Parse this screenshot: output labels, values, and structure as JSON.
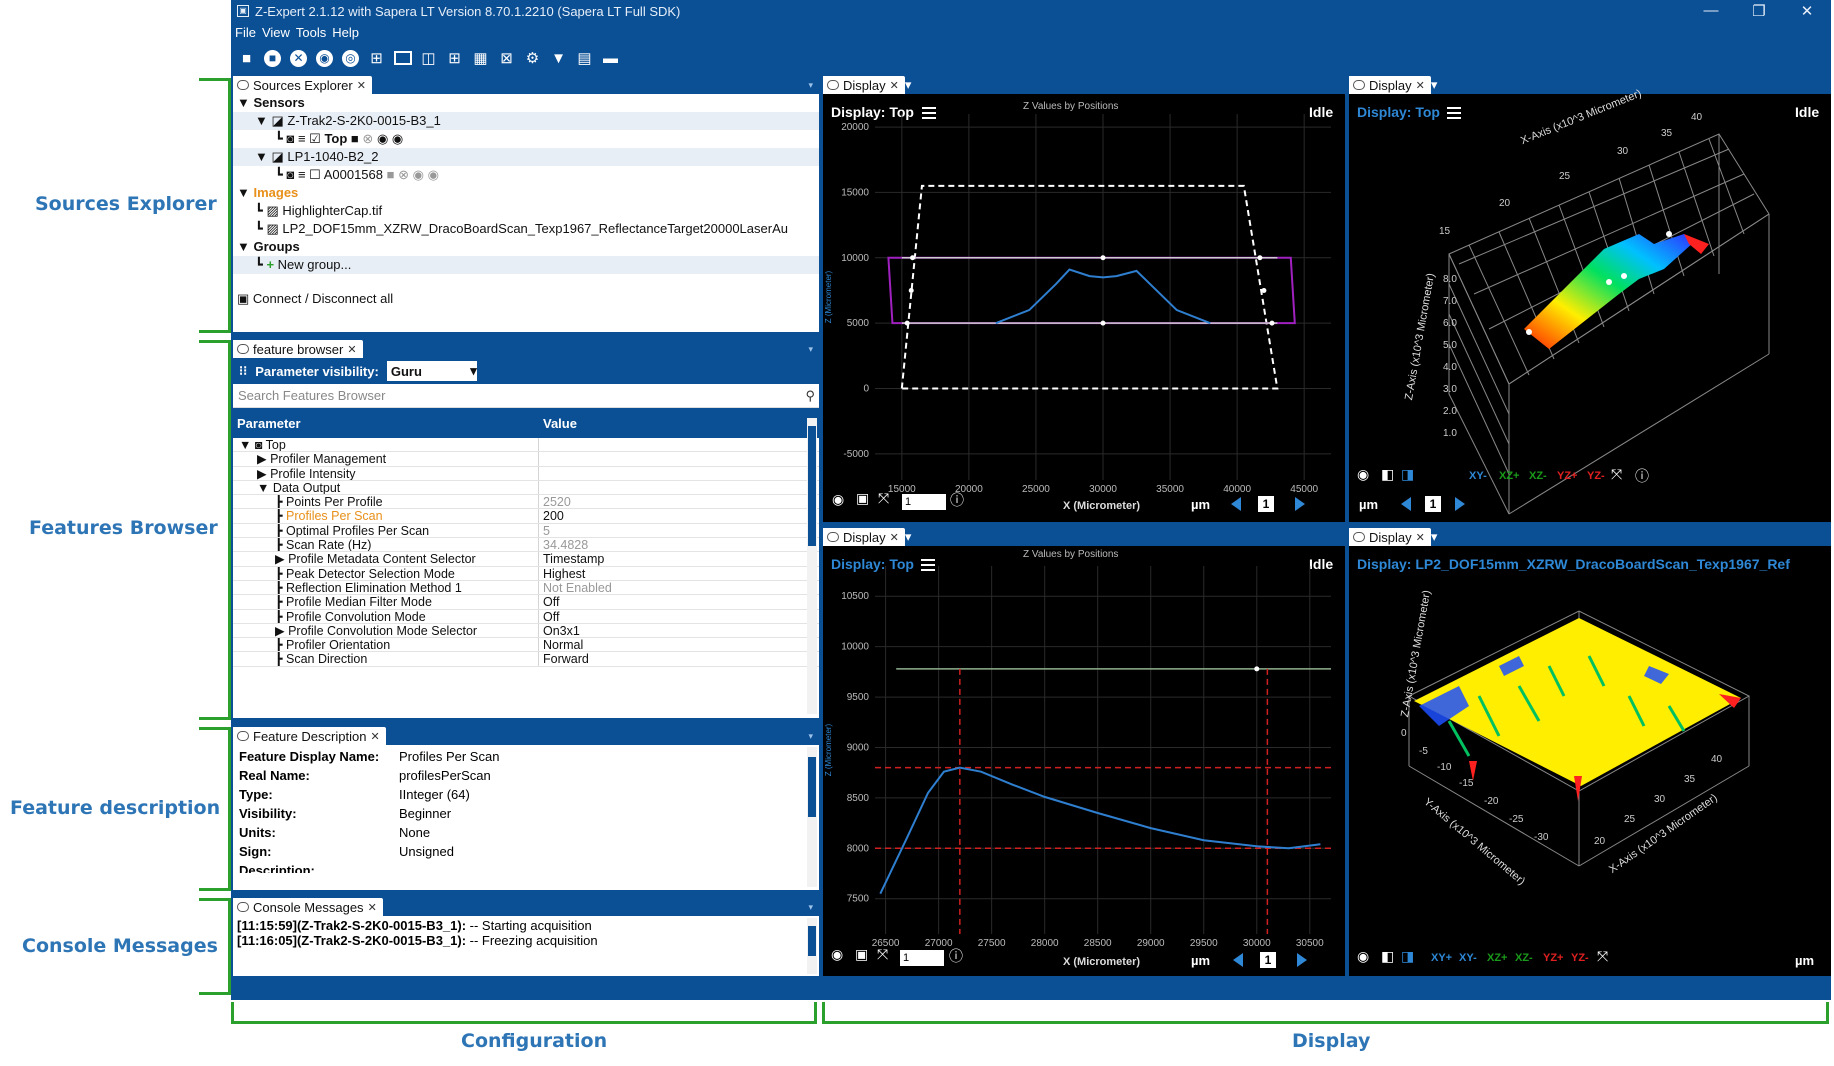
{
  "window": {
    "title": "Z-Expert 2.1.12 with Sapera LT Version 8.70.1.2210 (Sapera LT Full SDK)",
    "controls": [
      "—",
      "❐",
      "✕"
    ]
  },
  "menu": [
    "File",
    "View",
    "Tools",
    "Help"
  ],
  "annotations": {
    "sources_explorer": "Sources Explorer",
    "features_browser": "Features Browser",
    "feature_description": "Feature description",
    "console_messages": "Console Messages",
    "configuration": "Configuration",
    "display": "Display"
  },
  "sources": {
    "tab": "Sources Explorer",
    "sensors_label": "Sensors",
    "sensor1": "Z-Trak2-S-2K0-0015-B3_1",
    "sensor1_child": "Top",
    "sensor2": "LP1-1040-B2_2",
    "sensor2_child": "A0001568",
    "images_label": "Images",
    "image1": "HighlighterCap.tif",
    "image2": "LP2_DOF15mm_XZRW_DracoBoardScan_Texp1967_ReflectanceTarget20000LaserAu",
    "groups_label": "Groups",
    "new_group": "New group...",
    "connect_all": "Connect / Disconnect all"
  },
  "features": {
    "tab": "feature browser",
    "visibility_label": "Parameter visibility:",
    "visibility_value": "Guru",
    "search_placeholder": "Search Features Browser",
    "col_param": "Parameter",
    "col_value": "Value",
    "rows": [
      {
        "name": "Top",
        "value": ""
      },
      {
        "name": "Profiler Management",
        "value": ""
      },
      {
        "name": "Profile Intensity",
        "value": ""
      },
      {
        "name": "Data Output",
        "value": ""
      },
      {
        "name": "Points Per Profile",
        "value": "2520"
      },
      {
        "name": "Profiles Per Scan",
        "value": "200"
      },
      {
        "name": "Optimal Profiles Per Scan",
        "value": "5"
      },
      {
        "name": "Scan Rate (Hz)",
        "value": "34.4828"
      },
      {
        "name": "Profile Metadata Content Selector",
        "value": "Timestamp"
      },
      {
        "name": "Peak Detector Selection Mode",
        "value": "Highest"
      },
      {
        "name": "Reflection Elimination Method 1",
        "value": "Not Enabled"
      },
      {
        "name": "Profile Median Filter Mode",
        "value": "Off"
      },
      {
        "name": "Profile Convolution Mode",
        "value": "Off"
      },
      {
        "name": "Profile Convolution Mode Selector",
        "value": "On3x1"
      },
      {
        "name": "Profiler Orientation",
        "value": "Normal"
      },
      {
        "name": "Scan Direction",
        "value": "Forward"
      }
    ]
  },
  "description": {
    "tab": "Feature Description",
    "fields": [
      {
        "k": "Feature Display Name:",
        "v": "Profiles Per Scan"
      },
      {
        "k": "Real Name:",
        "v": "profilesPerScan"
      },
      {
        "k": "Type:",
        "v": "IInteger (64)"
      },
      {
        "k": "Visibility:",
        "v": "Beginner"
      },
      {
        "k": "Units:",
        "v": "None"
      },
      {
        "k": "Sign:",
        "v": "Unsigned"
      }
    ],
    "more": "Description:"
  },
  "console": {
    "tab": "Console Messages",
    "lines": [
      {
        "src": "[11:15:59](Z-Trak2-S-2K0-0015-B3_1):",
        "msg": " -- Starting acquisition"
      },
      {
        "src": "[11:16:05](Z-Trak2-S-2K0-0015-B3_1):",
        "msg": " -- Freezing acquisition"
      }
    ]
  },
  "displays": {
    "tab": "Display",
    "d1": {
      "title": "Display: Top",
      "state": "Idle",
      "chart_title": "Z Values by Positions",
      "frame": "1",
      "unit": "µm",
      "xlabel": "X (Micrometer)",
      "ylabel": "Z (Micrometer)",
      "spin": "1"
    },
    "d2": {
      "title": "Display: Top",
      "state": "Idle",
      "frame": "1",
      "unit": "µm",
      "xaxis": "X-Axis (x10^3 Micrometer)",
      "zaxis": "Z-Axis (x10^3 Micrometer)",
      "buttons": [
        "XY+",
        "XY-",
        "XZ+",
        "XZ-",
        "YZ+",
        "YZ-"
      ]
    },
    "d3": {
      "title": "Display: Top",
      "state": "Idle",
      "chart_title": "Z Values by Positions",
      "frame": "1",
      "unit": "µm",
      "xlabel": "X (Micrometer)",
      "ylabel": "Z (Micrometer)",
      "spin": "1"
    },
    "d4": {
      "title": "Display: LP2_DOF15mm_XZRW_DracoBoardScan_Texp1967_Ref",
      "unit": "µm",
      "xaxis": "X-Axis (x10^3 Micrometer)",
      "yaxis": "Y-Axis (x10^3 Micrometer)",
      "zaxis": "Z-Axis (x10^3 Micrometer)",
      "buttons": [
        "XY+",
        "XY-",
        "XZ+",
        "XZ-",
        "YZ+",
        "YZ-"
      ]
    }
  },
  "chart_data": [
    {
      "type": "line",
      "title": "Z Values by Positions",
      "xlabel": "X (Micrometer)",
      "ylabel": "Z (Micrometer)",
      "xlim": [
        13000,
        47000
      ],
      "ylim": [
        -7000,
        21000
      ],
      "x_ticks": [
        15000,
        20000,
        25000,
        30000,
        35000,
        40000,
        45000
      ],
      "y_ticks": [
        -5000,
        0,
        5000,
        10000,
        15000,
        20000
      ],
      "series": [
        {
          "values": [
            [
              22000,
              5000
            ],
            [
              24500,
              6000
            ],
            [
              26500,
              8000
            ],
            [
              27500,
              9100
            ],
            [
              29000,
              8600
            ],
            [
              30000,
              8500
            ],
            [
              31000,
              8600
            ],
            [
              32500,
              9000
            ],
            [
              33500,
              8000
            ],
            [
              35500,
              6000
            ],
            [
              38000,
              5000
            ]
          ]
        }
      ],
      "roi_outer": [
        [
          15000,
          0
        ],
        [
          16500,
          15500
        ],
        [
          40500,
          15500
        ],
        [
          43000,
          0
        ]
      ],
      "roi_lines": [
        10000,
        5000
      ]
    },
    {
      "type": "line",
      "title": "Z Values by Positions",
      "xlabel": "X (Micrometer)",
      "ylabel": "Z (Micrometer)",
      "xlim": [
        26400,
        30700
      ],
      "ylim": [
        7150,
        10800
      ],
      "x_ticks": [
        26500,
        27000,
        27500,
        28000,
        28500,
        29000,
        29500,
        30000,
        30500
      ],
      "y_ticks": [
        7500,
        8000,
        8500,
        9000,
        9500,
        10000,
        10500
      ],
      "series": [
        {
          "values": [
            [
              26450,
              7550
            ],
            [
              26700,
              8100
            ],
            [
              26900,
              8550
            ],
            [
              27050,
              8760
            ],
            [
              27200,
              8800
            ],
            [
              27400,
              8760
            ],
            [
              27700,
              8630
            ],
            [
              28000,
              8510
            ],
            [
              28500,
              8350
            ],
            [
              29000,
              8200
            ],
            [
              29500,
              8080
            ],
            [
              30000,
              8020
            ],
            [
              30300,
              8000
            ],
            [
              30600,
              8040
            ]
          ]
        }
      ],
      "hline": 9780,
      "vlines": [
        27200,
        30100
      ],
      "hlines_dashed": [
        8800,
        8000
      ]
    }
  ]
}
